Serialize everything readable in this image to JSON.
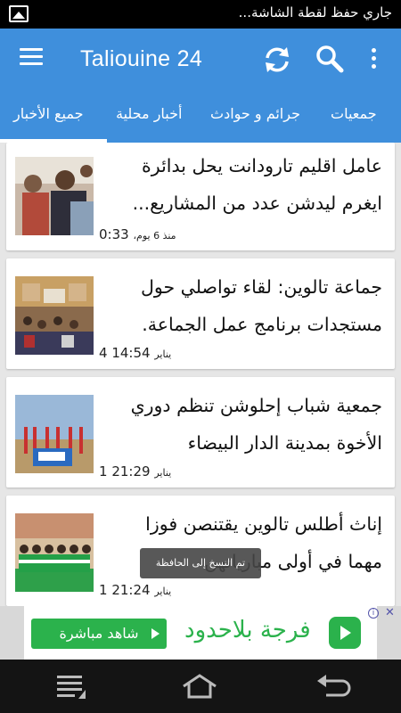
{
  "status_bar": {
    "notification_text": "جاري حفظ لقطة الشاشة...",
    "icon": "image-icon"
  },
  "app_bar": {
    "title": "Taliouine 24",
    "menu_icon": "menu-icon",
    "refresh_icon": "refresh-icon",
    "search_icon": "search-icon",
    "overflow_icon": "overflow-icon",
    "color": "#3f8fdc"
  },
  "tabs": [
    {
      "label": "جميع الأخبار",
      "active": true
    },
    {
      "label": "أخبار محلية",
      "active": false
    },
    {
      "label": "جرائم و حوادث",
      "active": false
    },
    {
      "label": "جمعيات",
      "active": false
    }
  ],
  "articles": [
    {
      "line1": "عامل اقليم تارودانت يحل بدائرة",
      "line2": "ايغرم ليدشن عدد من المشاريع...",
      "time": "0:33",
      "time_prefix": "منذ 6 يوم،",
      "image": "official-visit-photo"
    },
    {
      "line1": "جماعة تالوين: لقاء تواصلي حول",
      "line2": "مستجدات برنامج عمل الجماعة.",
      "time": "14:54 4",
      "time_prefix": "يناير",
      "image": "meeting-hall-photo"
    },
    {
      "line1": "جمعية شباب إحلوشن تنظم دوري",
      "line2": "الأخوة بمدينة الدار البيضاء",
      "time": "21:29 1",
      "time_prefix": "يناير",
      "image": "football-team-photo"
    },
    {
      "line1": "إناث أطلس تالوين يقتنصن فوزا",
      "line2": "مهما في أولى مبارياتهن",
      "time": "21:24 1",
      "time_prefix": "يناير",
      "image": "women-team-photo"
    }
  ],
  "toast": "تم النسخ إلى الحافظة",
  "ad": {
    "button_label": "شاهد مباشرة",
    "text": "فرجة بلاحدود",
    "info": "i",
    "close": "✕",
    "color": "#2bb24c"
  },
  "nav_bar": {
    "recent": "recent-apps-icon",
    "home": "home-icon",
    "back": "back-icon"
  }
}
